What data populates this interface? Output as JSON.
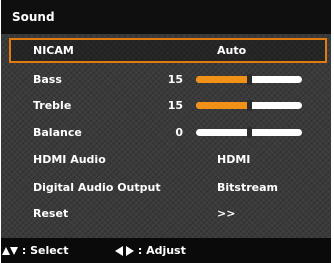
{
  "title": "Sound",
  "colors": {
    "highlight": "#e07b10",
    "slider_fill": "#f29118",
    "slider_track": "#ffffff",
    "panel_bg": "#3a3a3a"
  },
  "items": [
    {
      "label": "NICAM",
      "value": "Auto",
      "selected": true
    },
    {
      "label": "Bass",
      "number": "15",
      "level_fraction": 0.5
    },
    {
      "label": "Treble",
      "number": "15",
      "level_fraction": 0.5
    },
    {
      "label": "Balance",
      "number": "0",
      "level_fraction": 0.5
    },
    {
      "label": "HDMI Audio",
      "value": "HDMI"
    },
    {
      "label": "Digital Audio Output",
      "value": "Bitstream"
    },
    {
      "label": "Reset",
      "value": ">>"
    }
  ],
  "footer": {
    "select_icons": [
      "arrow-up-icon",
      "arrow-down-icon"
    ],
    "select_label": ": Select",
    "adjust_icons": [
      "arrow-left-icon",
      "arrow-right-icon"
    ],
    "adjust_label": ": Adjust"
  }
}
